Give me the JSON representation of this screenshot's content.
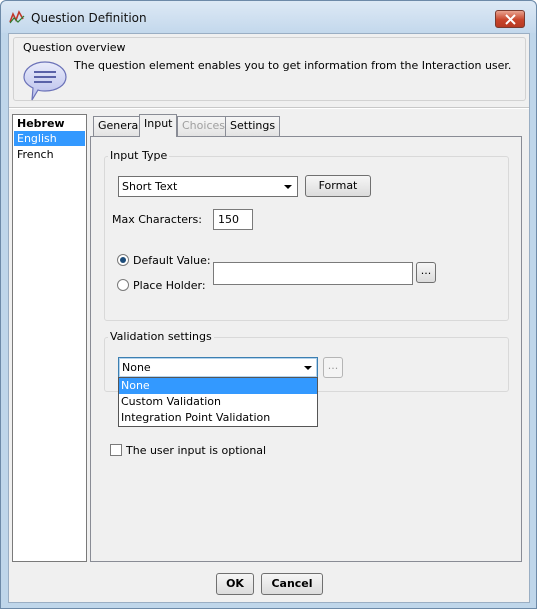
{
  "window": {
    "title": "Question Definition"
  },
  "overview": {
    "title": "Question overview",
    "description": "The question element enables you to get information from the Interaction user."
  },
  "languages": {
    "items": [
      {
        "label": "Hebrew",
        "bold": true
      },
      {
        "label": "English",
        "selected": true
      },
      {
        "label": "French"
      }
    ]
  },
  "tabs": [
    {
      "label": "General"
    },
    {
      "label": "Input",
      "active": true
    },
    {
      "label": "Choices",
      "disabled": true
    },
    {
      "label": "Settings"
    }
  ],
  "input_type": {
    "group_label": "Input Type",
    "type_value": "Short Text",
    "format_label": "Format",
    "max_chars_label": "Max Characters:",
    "max_chars_value": "150",
    "default_value_label": "Default Value:",
    "place_holder_label": "Place Holder:",
    "default_field_value": "",
    "ellipsis": "..."
  },
  "validation": {
    "group_label": "Validation settings",
    "selected": "None",
    "ellipsis": "...",
    "options": [
      "None",
      "Custom Validation",
      "Integration Point Validation"
    ]
  },
  "optional": {
    "label": "The user input is optional",
    "checked": false
  },
  "buttons": {
    "ok": "OK",
    "cancel": "Cancel"
  },
  "colors": {
    "selection": "#3399ff",
    "title_bar": "#c3d8ec",
    "close_button": "#c8452b"
  }
}
